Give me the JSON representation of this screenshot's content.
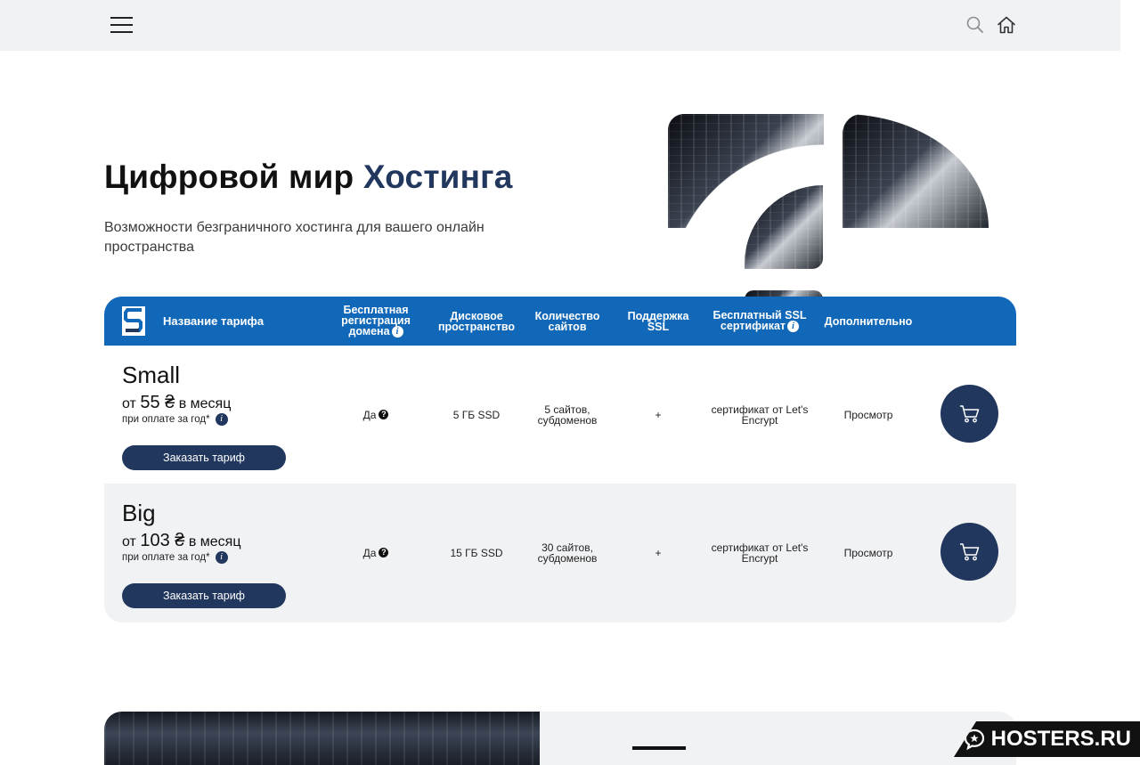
{
  "header": {
    "menu_icon": "hamburger-icon",
    "search_icon": "search-icon",
    "home_icon": "home-icon"
  },
  "hero": {
    "title_main": "Цифровой мир ",
    "title_accent": "Хостинга",
    "subtitle": "Возможности безграничного хостинга для вашего онлайн пространства"
  },
  "table": {
    "headers": {
      "name": "Название тарифа",
      "domain": "Бесплатная регистрация домена",
      "disk": "Дисковое пространство",
      "sites": "Количество сайтов",
      "ssl_support": "Поддержка SSL",
      "ssl_cert": "Бесплатный SSL сертификат",
      "extra": "Дополнительно"
    },
    "plans": [
      {
        "name": "Small",
        "price_prefix": "от ",
        "price_value": "55 ₴",
        "price_suffix": " в месяц",
        "note": "при оплате за год*",
        "domain": "Да",
        "disk": "5 ГБ SSD",
        "sites": "5 сайтов, субдоменов",
        "ssl_support": "+",
        "ssl_cert": "сертификат от Let's Encrypt",
        "extra": "Просмотр",
        "order_label": "Заказать тариф"
      },
      {
        "name": "Big",
        "price_prefix": "от ",
        "price_value": "103 ₴",
        "price_suffix": " в месяц",
        "note": "при оплате за год*",
        "domain": "Да",
        "disk": "15 ГБ SSD",
        "sites": "30 сайтов, субдоменов",
        "ssl_support": "+",
        "ssl_cert": "сертификат от Let's Encrypt",
        "extra": "Просмотр",
        "order_label": "Заказать тариф"
      }
    ]
  },
  "watermark": {
    "text": "HOSTERS.RU"
  },
  "colors": {
    "navy": "#21375e",
    "header_blue": "#1268b8",
    "light_gray": "#f1f2f4"
  }
}
